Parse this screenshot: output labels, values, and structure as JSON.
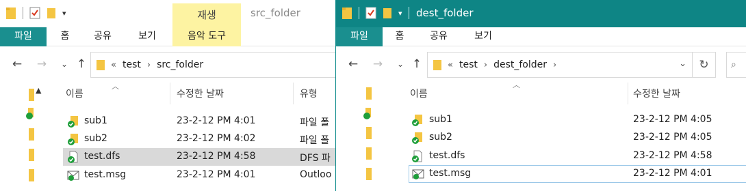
{
  "left": {
    "title": "src_folder",
    "context_tab": "재생",
    "ribbon_tabs": [
      "파일",
      "홈",
      "공유",
      "보기",
      "음악 도구"
    ],
    "breadcrumb": {
      "overflow": "«",
      "parts": [
        "test",
        "src_folder"
      ]
    },
    "columns": {
      "name": "이름",
      "date": "수정한 날짜",
      "type": "유형"
    },
    "rows": [
      {
        "name": "sub1",
        "date": "23-2-12 PM 4:01",
        "type": "파일 폴"
      },
      {
        "name": "sub2",
        "date": "23-2-12 PM 4:02",
        "type": "파일 폴"
      },
      {
        "name": "test.dfs",
        "date": "23-2-12 PM 4:58",
        "type": "DFS 파"
      },
      {
        "name": "test.msg",
        "date": "23-2-12 PM 4:01",
        "type": "Outloo"
      }
    ]
  },
  "right": {
    "title": "dest_folder",
    "ribbon_tabs": [
      "파일",
      "홈",
      "공유",
      "보기"
    ],
    "breadcrumb": {
      "overflow": "«",
      "parts": [
        "test",
        "dest_folder"
      ]
    },
    "columns": {
      "name": "이름",
      "date": "수정한 날짜"
    },
    "rows": [
      {
        "name": "sub1",
        "date": "23-2-12 PM 4:05"
      },
      {
        "name": "sub2",
        "date": "23-2-12 PM 4:05"
      },
      {
        "name": "test.dfs",
        "date": "23-2-12 PM 4:58"
      },
      {
        "name": "test.msg",
        "date": "23-2-12 PM 4:01"
      }
    ]
  },
  "colors": {
    "accent": "#1a8f8f",
    "titlebar_active": "#0e8585",
    "context_tab": "#fdf3a2",
    "selected_row": "#d9d9d9"
  }
}
